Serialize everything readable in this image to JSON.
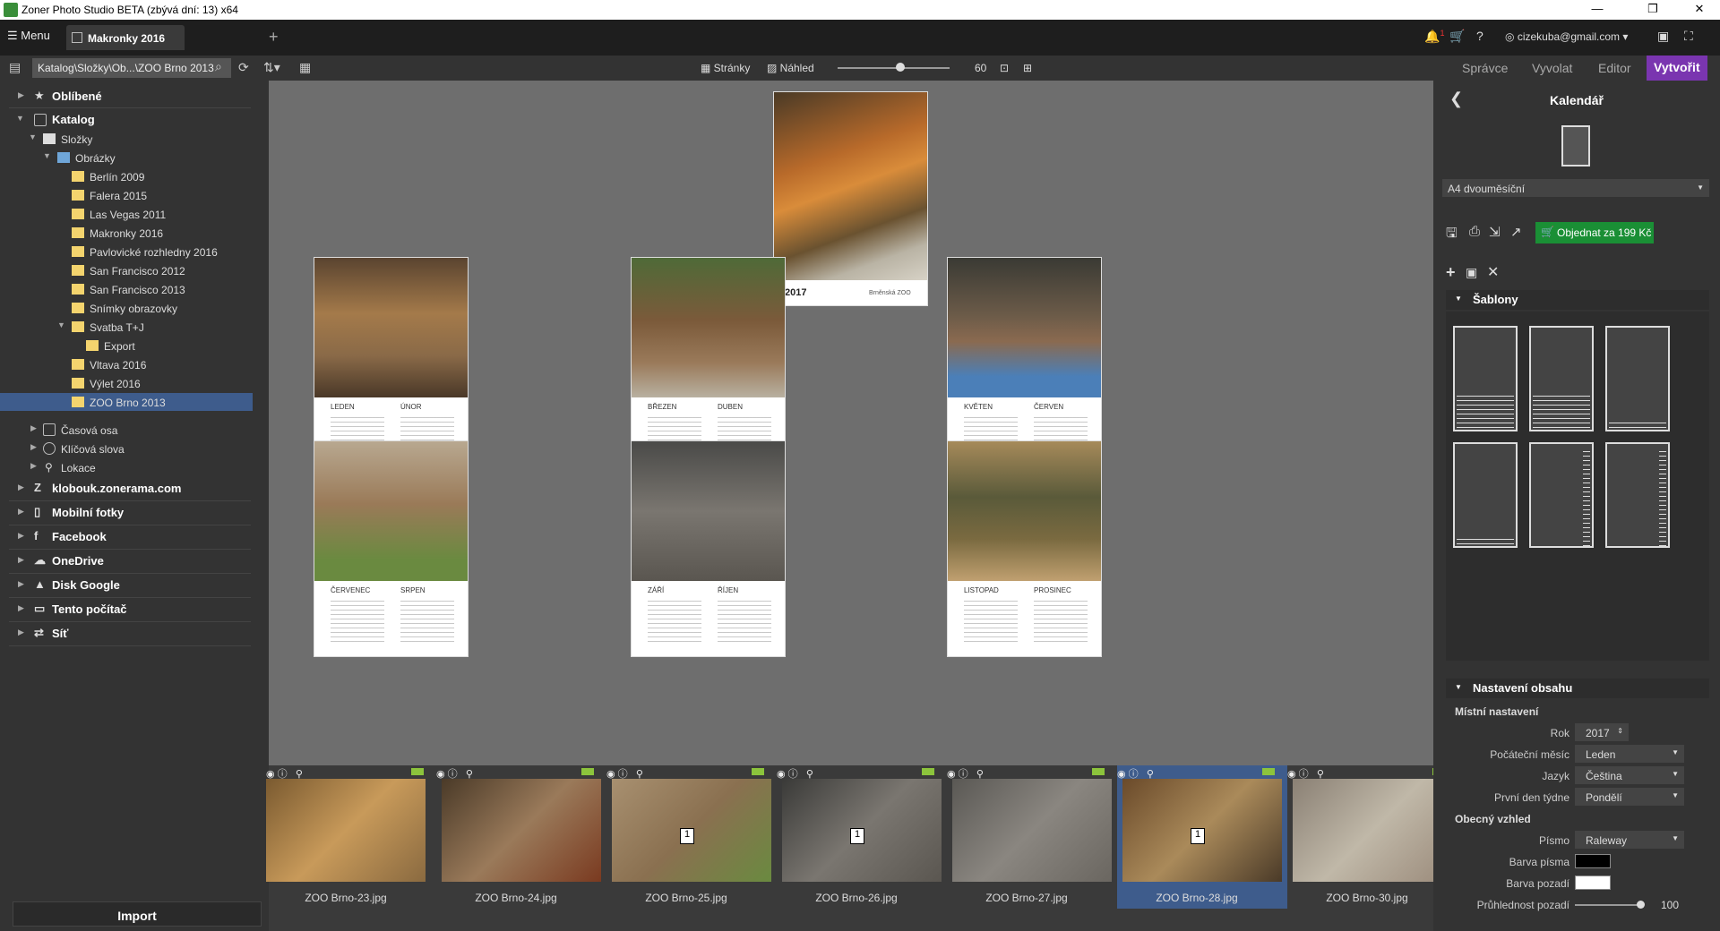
{
  "window": {
    "title": "Zoner Photo Studio BETA (zbývá dní: 13) x64"
  },
  "tabbar": {
    "menu_label": "Menu",
    "tab_label": "Makronky 2016",
    "user": "cizekuba@gmail.com",
    "notification_count": "1"
  },
  "toolbar": {
    "path": "Katalog\\Složky\\Ob...\\ZOO Brno 2013",
    "view_pages": "Stránky",
    "view_preview": "Náhled",
    "zoom": "60",
    "modes": [
      "Správce",
      "Vyvolat",
      "Editor",
      "Vytvořit"
    ]
  },
  "sidebar": {
    "favorites": "Oblíbené",
    "catalog": "Katalog",
    "folders": "Složky",
    "pictures": "Obrázky",
    "subfolders": [
      "Berlín 2009",
      "Falera 2015",
      "Las Vegas 2011",
      "Makronky 2016",
      "Pavlovické rozhledny 2016",
      "San Francisco 2012",
      "San Francisco 2013",
      "Snímky obrazovky",
      "Svatba T+J",
      "Export",
      "Vltava 2016",
      "Výlet 2016",
      "ZOO Brno 2013"
    ],
    "timeline": "Časová osa",
    "keywords": "Klíčová slova",
    "locations": "Lokace",
    "sources": [
      "klobouk.zonerama.com",
      "Mobilní fotky",
      "Facebook",
      "OneDrive",
      "Disk Google",
      "Tento počítač",
      "Síť"
    ],
    "import_label": "Import"
  },
  "calendar": {
    "cover_year": "2017",
    "cover_sub": "Brněnská ZOO",
    "pages": [
      [
        "LEDEN",
        "ÚNOR"
      ],
      [
        "BŘEZEN",
        "DUBEN"
      ],
      [
        "KVĚTEN",
        "ČERVEN"
      ],
      [
        "ČERVENEC",
        "SRPEN"
      ],
      [
        "ZÁŘÍ",
        "ŘÍJEN"
      ],
      [
        "LISTOPAD",
        "PROSINEC"
      ]
    ]
  },
  "filmstrip": {
    "items": [
      {
        "name": "ZOO Brno-23.jpg",
        "badge": ""
      },
      {
        "name": "ZOO Brno-24.jpg",
        "badge": ""
      },
      {
        "name": "ZOO Brno-25.jpg",
        "badge": "1"
      },
      {
        "name": "ZOO Brno-26.jpg",
        "badge": "1"
      },
      {
        "name": "ZOO Brno-27.jpg",
        "badge": ""
      },
      {
        "name": "ZOO Brno-28.jpg",
        "badge": "1"
      },
      {
        "name": "ZOO Brno-30.jpg",
        "badge": ""
      }
    ],
    "selected": "ZOO Brno-28.jpg"
  },
  "panel": {
    "title": "Kalendář",
    "format": "A4 dvouměsíční",
    "order_label": "Objednat za 199 Kč",
    "templates_label": "Šablony",
    "content_label": "Nastavení obsahu",
    "local_settings": "Místní nastavení",
    "year_label": "Rok",
    "year_value": "2017",
    "start_month_label": "Počáteční měsíc",
    "start_month_value": "Leden",
    "language_label": "Jazyk",
    "language_value": "Čeština",
    "first_day_label": "První den týdne",
    "first_day_value": "Pondělí",
    "general_look": "Obecný vzhled",
    "font_label": "Písmo",
    "font_value": "Raleway",
    "font_color_label": "Barva písma",
    "font_color": "#000000",
    "bg_color_label": "Barva pozadí",
    "bg_color": "#ffffff",
    "bg_opacity_label": "Průhlednost pozadí",
    "bg_opacity_value": "100"
  },
  "colors": {
    "accent": "#7a35b0",
    "selection": "#3e5c8c",
    "order": "#1a8f35"
  }
}
